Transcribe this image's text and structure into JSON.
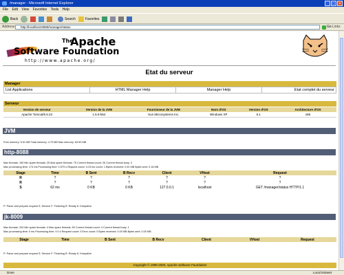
{
  "window": {
    "title": "/manager - Microsoft Internet Explorer",
    "controls": [
      "_",
      "□",
      "×"
    ]
  },
  "menu": [
    "File",
    "Edit",
    "View",
    "Favorites",
    "Tools",
    "Help"
  ],
  "toolbar": {
    "back": "Back",
    "search": "Search",
    "favorites": "Favorites"
  },
  "address": {
    "label": "Address",
    "url": "http://localhost:8080/manager/status",
    "go": "Go",
    "links": "Links"
  },
  "logo": {
    "the": "The",
    "apache": "Apache",
    "software_foundation": "Software Foundation",
    "url": "http://www.apache.org/"
  },
  "page_title": "Etat du serveur",
  "manager": {
    "header": "Manager",
    "links": [
      "List Applications",
      "HTML Manager Help",
      "Manager Help",
      "Etat complet du serveur"
    ]
  },
  "server": {
    "header": "Serveur",
    "columns": [
      "Version de serveur",
      "Version de la JVM",
      "Fournisseur de la JVM",
      "Nom d'OS",
      "Version d'OS",
      "Architecture d'OS"
    ],
    "row": [
      "Apache Tomcat/5.5.23",
      "1.5.0-b64",
      "Sun Microsystems Inc.",
      "Windows XP",
      "5.1",
      "x86"
    ]
  },
  "jvm": {
    "header": "JVM",
    "info": "Free memory: 6.51 MB Total memory: 4.70 MB Max memory: 63.50 MB"
  },
  "http": {
    "header": "http-8088",
    "info1": "Max threads: 150 Min spare threads: 25 Max spare threads: 75 Current thread count: 25 Current thread busy: 2",
    "info2": "Max processing time: 173 ms Processing time: 0.579 s Request count: 14 Error count: 1 Bytes received: 0.00 MB Bytes sent: 0.18 MB",
    "columns": [
      "Stage",
      "Time",
      "B Sent",
      "B Recv",
      "Client",
      "VHost",
      "Request"
    ],
    "rows": [
      [
        "R",
        "?",
        "?",
        "?",
        "?",
        "?",
        "?"
      ],
      [
        "R",
        "?",
        "?",
        "?",
        "?",
        "?",
        "?"
      ],
      [
        "S",
        "62 ms",
        "0 KB",
        "0 KB",
        "127.0.0.1",
        "localhost",
        "GET /manager/status HTTP/1.1"
      ]
    ],
    "legend": "P: Parse and prepare request S: Service F: Finishing R: Ready K: Keepalive"
  },
  "jk": {
    "header": "jk-8009",
    "info1": "Max threads: 200 Min spare threads: 4 Max spare threads: 50 Current thread count: 4 Current thread busy: 1",
    "info2": "Max processing time: 0 ms Processing time: 0.0 s Request count: 0 Error count: 0 Bytes received: 0.00 MB Bytes sent: 0.00 MB",
    "columns": [
      "Stage",
      "Time",
      "B Sent",
      "B Recv",
      "Client",
      "VHost",
      "Request"
    ],
    "legend": "P: Parse and prepare request S: Service F: Finishing R: Ready K: Keepalive"
  },
  "footer": "Copyright © 1999-2005, Apache Software Foundation",
  "status": {
    "left": "Done",
    "right": "Local intranet"
  }
}
